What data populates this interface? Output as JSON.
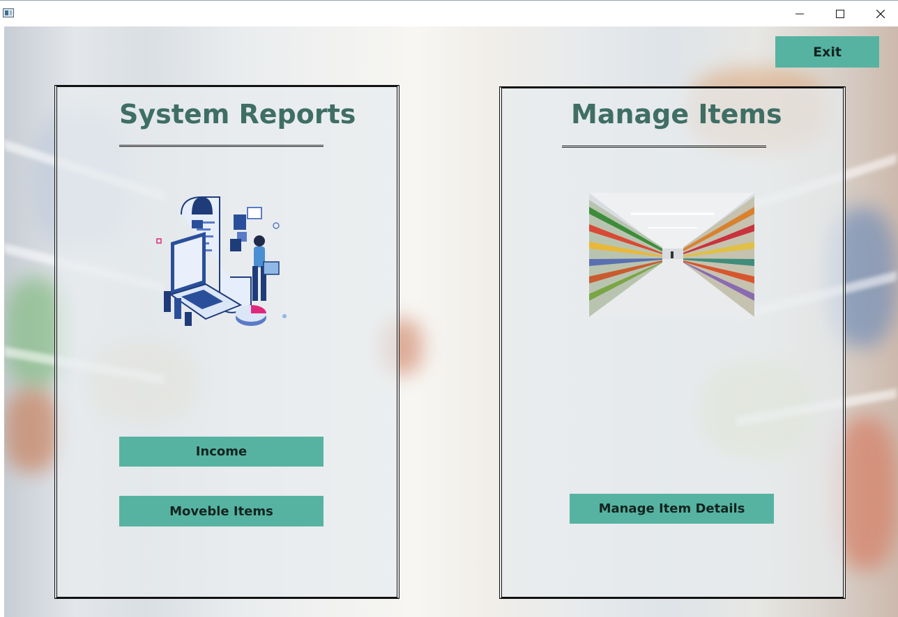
{
  "window": {
    "minimize_label": "minimize",
    "maximize_label": "maximize",
    "close_label": "close"
  },
  "exit_label": "Exit",
  "reports": {
    "title": "System Reports",
    "buttons": [
      "Income",
      "Moveble Items"
    ],
    "illustration_icon": "report-illustration-icon"
  },
  "items": {
    "title": "Manage Items",
    "button": "Manage Item Details",
    "image_icon": "supermarket-aisle-photo"
  },
  "colors": {
    "accent": "#56b3a1",
    "heading": "#3f6e64"
  }
}
